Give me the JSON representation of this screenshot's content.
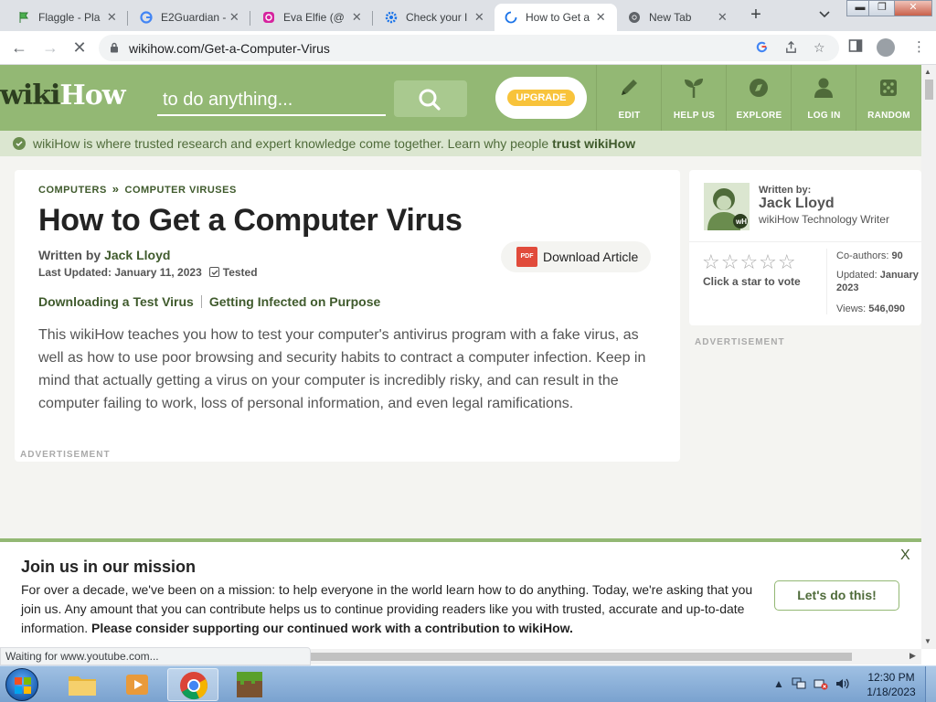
{
  "browser": {
    "tabs": [
      {
        "title": "Flaggle - Pla",
        "icon": "flaggle-icon",
        "color": "#4caf50"
      },
      {
        "title": "E2Guardian -",
        "icon": "google-icon",
        "color": "#4285f4"
      },
      {
        "title": "Eva Elfie (@",
        "icon": "instagram-icon",
        "color": "#d6249f"
      },
      {
        "title": "Check your I",
        "icon": "gear-icon",
        "color": "#1a73e8"
      },
      {
        "title": "How to Get a",
        "icon": "loading-icon",
        "color": "#1a73e8",
        "active": true
      },
      {
        "title": "New Tab",
        "icon": "chrome-icon",
        "color": "#5f6368"
      }
    ],
    "url": "wikihow.com/Get-a-Computer-Virus",
    "status": "Waiting for www.youtube.com..."
  },
  "wikihow": {
    "logo_wiki": "wiki",
    "logo_how": "How",
    "search_placeholder": "to do anything...",
    "upgrade": "UPGRADE",
    "nav": [
      {
        "label": "EDIT",
        "icon": "pencil-icon"
      },
      {
        "label": "HELP US",
        "icon": "sprout-icon"
      },
      {
        "label": "EXPLORE",
        "icon": "compass-icon"
      },
      {
        "label": "LOG IN",
        "icon": "user-icon"
      },
      {
        "label": "RANDOM",
        "icon": "dice-icon"
      }
    ],
    "trust_text": "wikiHow is where trusted research and expert knowledge come together. Learn why people ",
    "trust_link": "trust wikiHow",
    "accent": "#93b874"
  },
  "article": {
    "breadcrumbs": [
      "COMPUTERS",
      "COMPUTER VIRUSES"
    ],
    "breadcrumb_sep": "»",
    "title": "How to Get a Computer Virus",
    "written_by_label": "Written by ",
    "author": "Jack Lloyd",
    "last_updated": "Last Updated: January 11, 2023",
    "tested": "Tested",
    "download": "Download Article",
    "methods": [
      "Downloading a Test Virus",
      "Getting Infected on Purpose"
    ],
    "intro": "This wikiHow teaches you how to test your computer's antivirus program with a fake virus, as well as how to use poor browsing and security habits to contract a computer infection. Keep in mind that actually getting a virus on your computer is incredibly risky, and can result in the computer failing to work, loss of personal information, and even legal ramifications.",
    "advertisement": "ADVERTISEMENT"
  },
  "sidebar": {
    "written_by": "Written by:",
    "author": "Jack Lloyd",
    "role": "wikiHow Technology Writer",
    "vote": "Click a star to vote",
    "coauthors_label": "Co-authors: ",
    "coauthors": "90",
    "updated_label": "Updated: ",
    "updated_1": "January",
    "updated_2": "2023",
    "views_label": "Views: ",
    "views": "546,090",
    "stars": "☆☆☆☆☆",
    "advertisement": "ADVERTISEMENT"
  },
  "mission": {
    "title": "Join us in our mission",
    "body": "For over a decade, we've been on a mission: to help everyone in the world learn how to do anything. Today, we're asking that you join us. Any amount that you can contribute helps us to continue providing readers like you with trusted, accurate and up-to-date information. ",
    "body_bold": "Please consider supporting our continued work with a contribution to wikiHow.",
    "cta": "Let's do this!",
    "close": "X"
  },
  "taskbar": {
    "time": "12:30 PM",
    "date": "1/18/2023"
  }
}
